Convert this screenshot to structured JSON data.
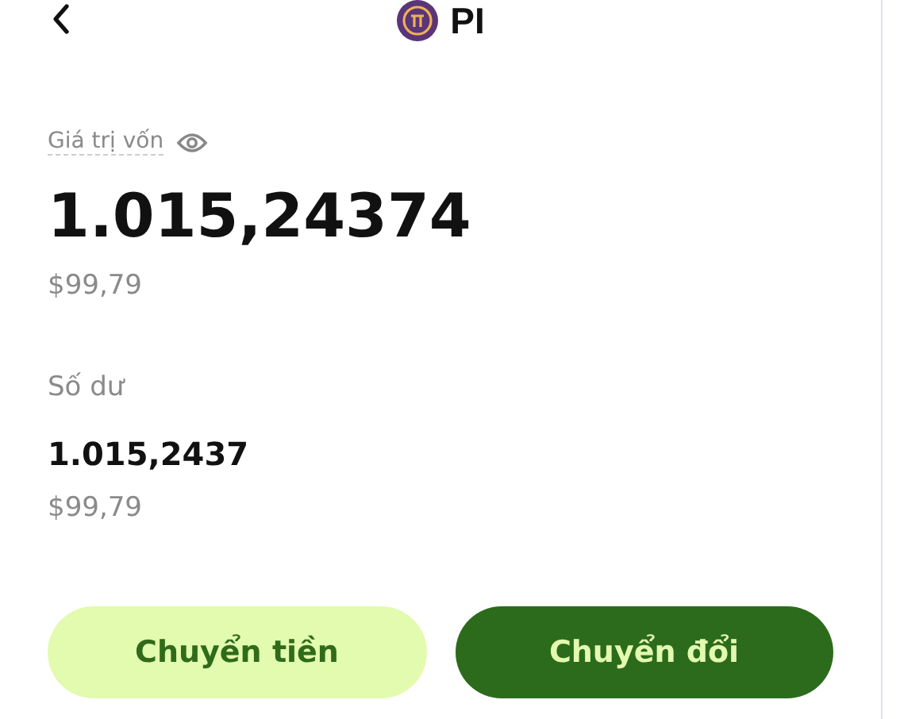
{
  "header": {
    "title": "PI"
  },
  "capital": {
    "label": "Giá trị vốn",
    "amount": "1.015,24374",
    "usd": "$99,79"
  },
  "balance": {
    "label": "Số dư",
    "amount": "1.015,2437",
    "usd": "$99,79"
  },
  "buttons": [
    {
      "label": "Chuyển tiền",
      "kind": "secondary"
    },
    {
      "label": "Chuyển đổi",
      "kind": "primary"
    }
  ]
}
